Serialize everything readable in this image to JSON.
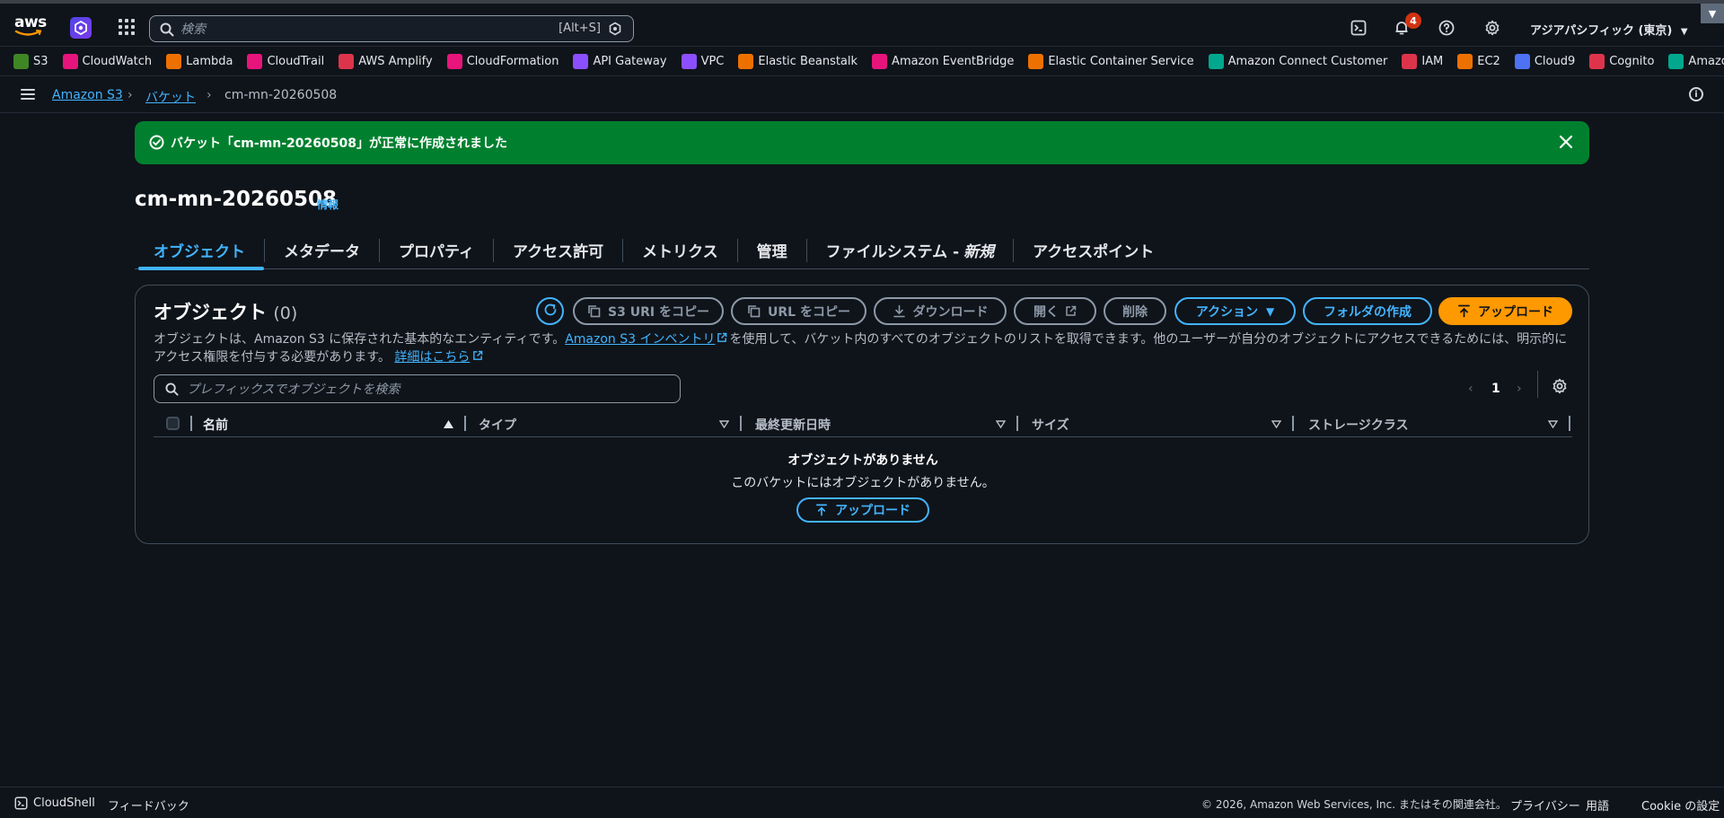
{
  "header": {
    "search_placeholder": "検索",
    "search_shortcut": "[Alt+S]",
    "notification_count": "4",
    "region": "アジアパシフィック (東京)"
  },
  "favorites": [
    {
      "label": "S3",
      "color": "#3f8624"
    },
    {
      "label": "CloudWatch",
      "color": "#e7157b"
    },
    {
      "label": "Lambda",
      "color": "#ed7100"
    },
    {
      "label": "CloudTrail",
      "color": "#e7157b"
    },
    {
      "label": "AWS Amplify",
      "color": "#dd344c"
    },
    {
      "label": "CloudFormation",
      "color": "#e7157b"
    },
    {
      "label": "API Gateway",
      "color": "#8c4fff"
    },
    {
      "label": "VPC",
      "color": "#8c4fff"
    },
    {
      "label": "Elastic Beanstalk",
      "color": "#ed7100"
    },
    {
      "label": "Amazon EventBridge",
      "color": "#e7157b"
    },
    {
      "label": "Elastic Container Service",
      "color": "#ed7100"
    },
    {
      "label": "Amazon Connect Customer",
      "color": "#01a88d"
    },
    {
      "label": "IAM",
      "color": "#dd344c"
    },
    {
      "label": "EC2",
      "color": "#ed7100"
    },
    {
      "label": "Cloud9",
      "color": "#4d72f3"
    },
    {
      "label": "Cognito",
      "color": "#dd344c"
    },
    {
      "label": "Amazon Polly",
      "color": "#01a88d"
    }
  ],
  "breadcrumb": {
    "root": "Amazon S3",
    "buckets": "バケット",
    "current": "cm-mn-20260508"
  },
  "flash": {
    "message": "バケット「cm-mn-20260508」が正常に作成されました"
  },
  "bucket": {
    "name": "cm-mn-20260508",
    "info": "情報"
  },
  "tabs": [
    "オブジェクト",
    "メタデータ",
    "プロパティ",
    "アクセス許可",
    "メトリクス",
    "管理",
    "ファイルシステム - ",
    "アクセスポイント"
  ],
  "tab_new_label": "新規",
  "objects": {
    "title": "オブジェクト",
    "count": "(0)",
    "buttons": {
      "copy_s3_uri": "S3 URI をコピー",
      "copy_url": "URL をコピー",
      "download": "ダウンロード",
      "open": "開く",
      "delete": "削除",
      "actions": "アクション",
      "create_folder": "フォルダの作成",
      "upload": "アップロード"
    },
    "desc_1": "オブジェクトは、Amazon S3 に保存された基本的なエンティティです。",
    "desc_link_1": "Amazon S3 インベントリ",
    "desc_2": "を使用して、バケット内のすべてのオブジェクトのリストを取得できます。他のユーザーが自分のオブジェクトにアクセスできるためには、明示的にアクセス権限を付与する必要があります。",
    "desc_link_2": "詳細はこちら",
    "search_placeholder": "プレフィックスでオブジェクトを検索",
    "page": "1",
    "columns": [
      "名前",
      "タイプ",
      "最終更新日時",
      "サイズ",
      "ストレージクラス"
    ],
    "empty_title": "オブジェクトがありません",
    "empty_sub": "このバケットにはオブジェクトがありません。",
    "empty_upload": "アップロード"
  },
  "footer": {
    "cloudshell": "CloudShell",
    "feedback": "フィードバック",
    "copyright": "© 2026, Amazon Web Services, Inc. またはその関連会社。",
    "privacy": "プライバシー",
    "terms": "用語",
    "cookies": "Cookie の設定"
  }
}
